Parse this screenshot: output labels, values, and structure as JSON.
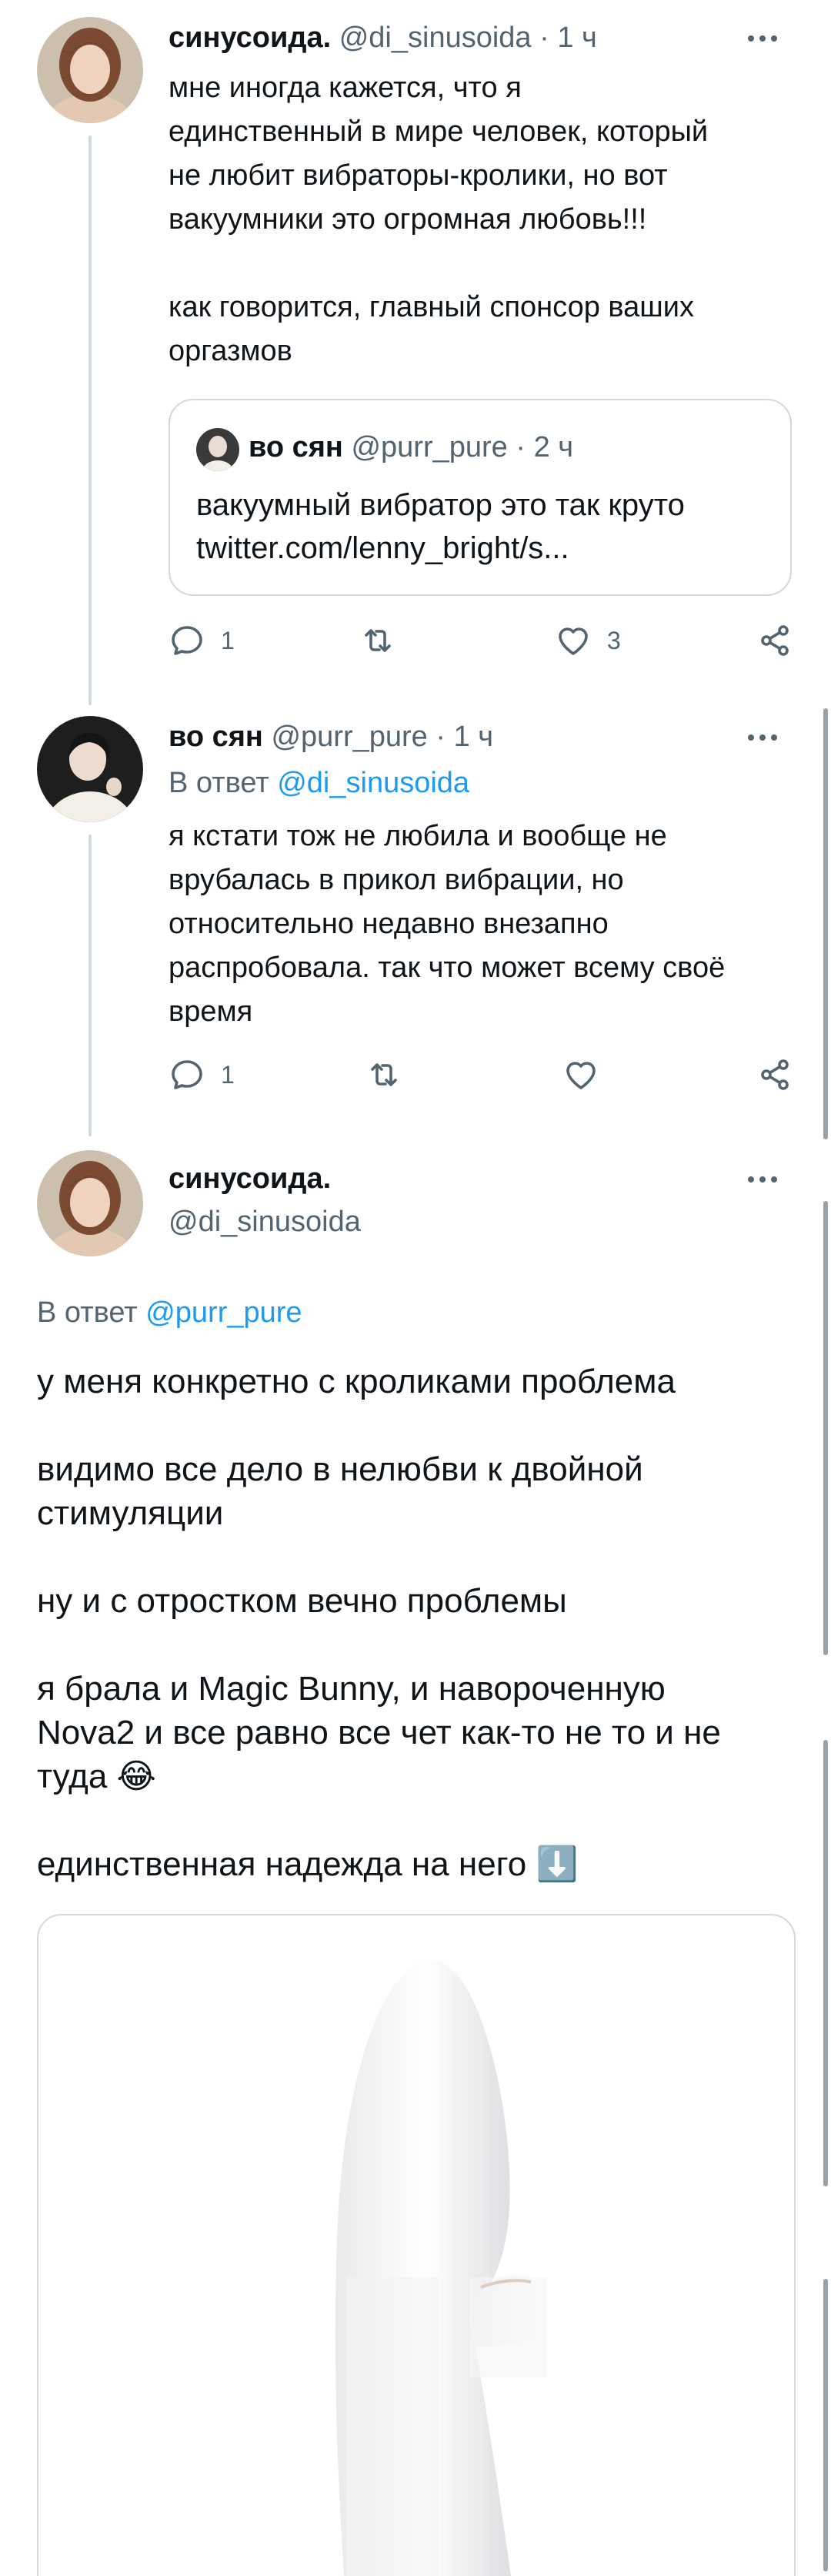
{
  "tweets": [
    {
      "name": "синусоида.",
      "handle": "@di_sinusoida",
      "separator": "·",
      "time": "1 ч",
      "text": "мне иногда кажется, что я\nединственный в мире человек, который\nне любит вибраторы-кролики, но вот\nвакуумники это огромная любовь!!!\n\nкак говорится, главный спонсор ваших\nоргазмов",
      "quote": {
        "name": "во сян",
        "handle": "@purr_pure",
        "separator": "·",
        "time": "2 ч",
        "text": "вакуумный вибратор это так круто\ntwitter.com/lenny_bright/s..."
      },
      "actions": {
        "replies": "1",
        "retweets": "",
        "likes": "3"
      }
    },
    {
      "name": "во сян",
      "handle": "@purr_pure",
      "separator": "·",
      "time": "1 ч",
      "reply_prefix": "В ответ",
      "reply_to": "@di_sinusoida",
      "text": "я кстати тож не любила и вообще не\nврубалась в прикол вибрации, но\nотносительно недавно внезапно\nраспробовала. так что может всему своё\nвремя",
      "actions": {
        "replies": "1",
        "retweets": "",
        "likes": ""
      }
    },
    {
      "name": "синусоида.",
      "handle": "@di_sinusoida",
      "reply_prefix": "В ответ",
      "reply_to": "@purr_pure",
      "text": "у меня конкретно с кроликами проблема\n\nвидимо все дело в нелюбви к двойной\nстимуляции\n\nну и с отростком вечно проблемы\n\nя брала и Magic Bunny, и навороченную\nNova2 и все равно все чет как-то не то и не\nтуда 😂\n\nединственная надежда на него ⬇️"
    }
  ],
  "icons": [
    "reply-icon",
    "retweet-icon",
    "like-icon",
    "share-icon",
    "more-icon"
  ],
  "colors": {
    "accent": "#1d9bf0",
    "muted": "#536471",
    "text": "#0f1419",
    "border": "#cfd9de"
  }
}
